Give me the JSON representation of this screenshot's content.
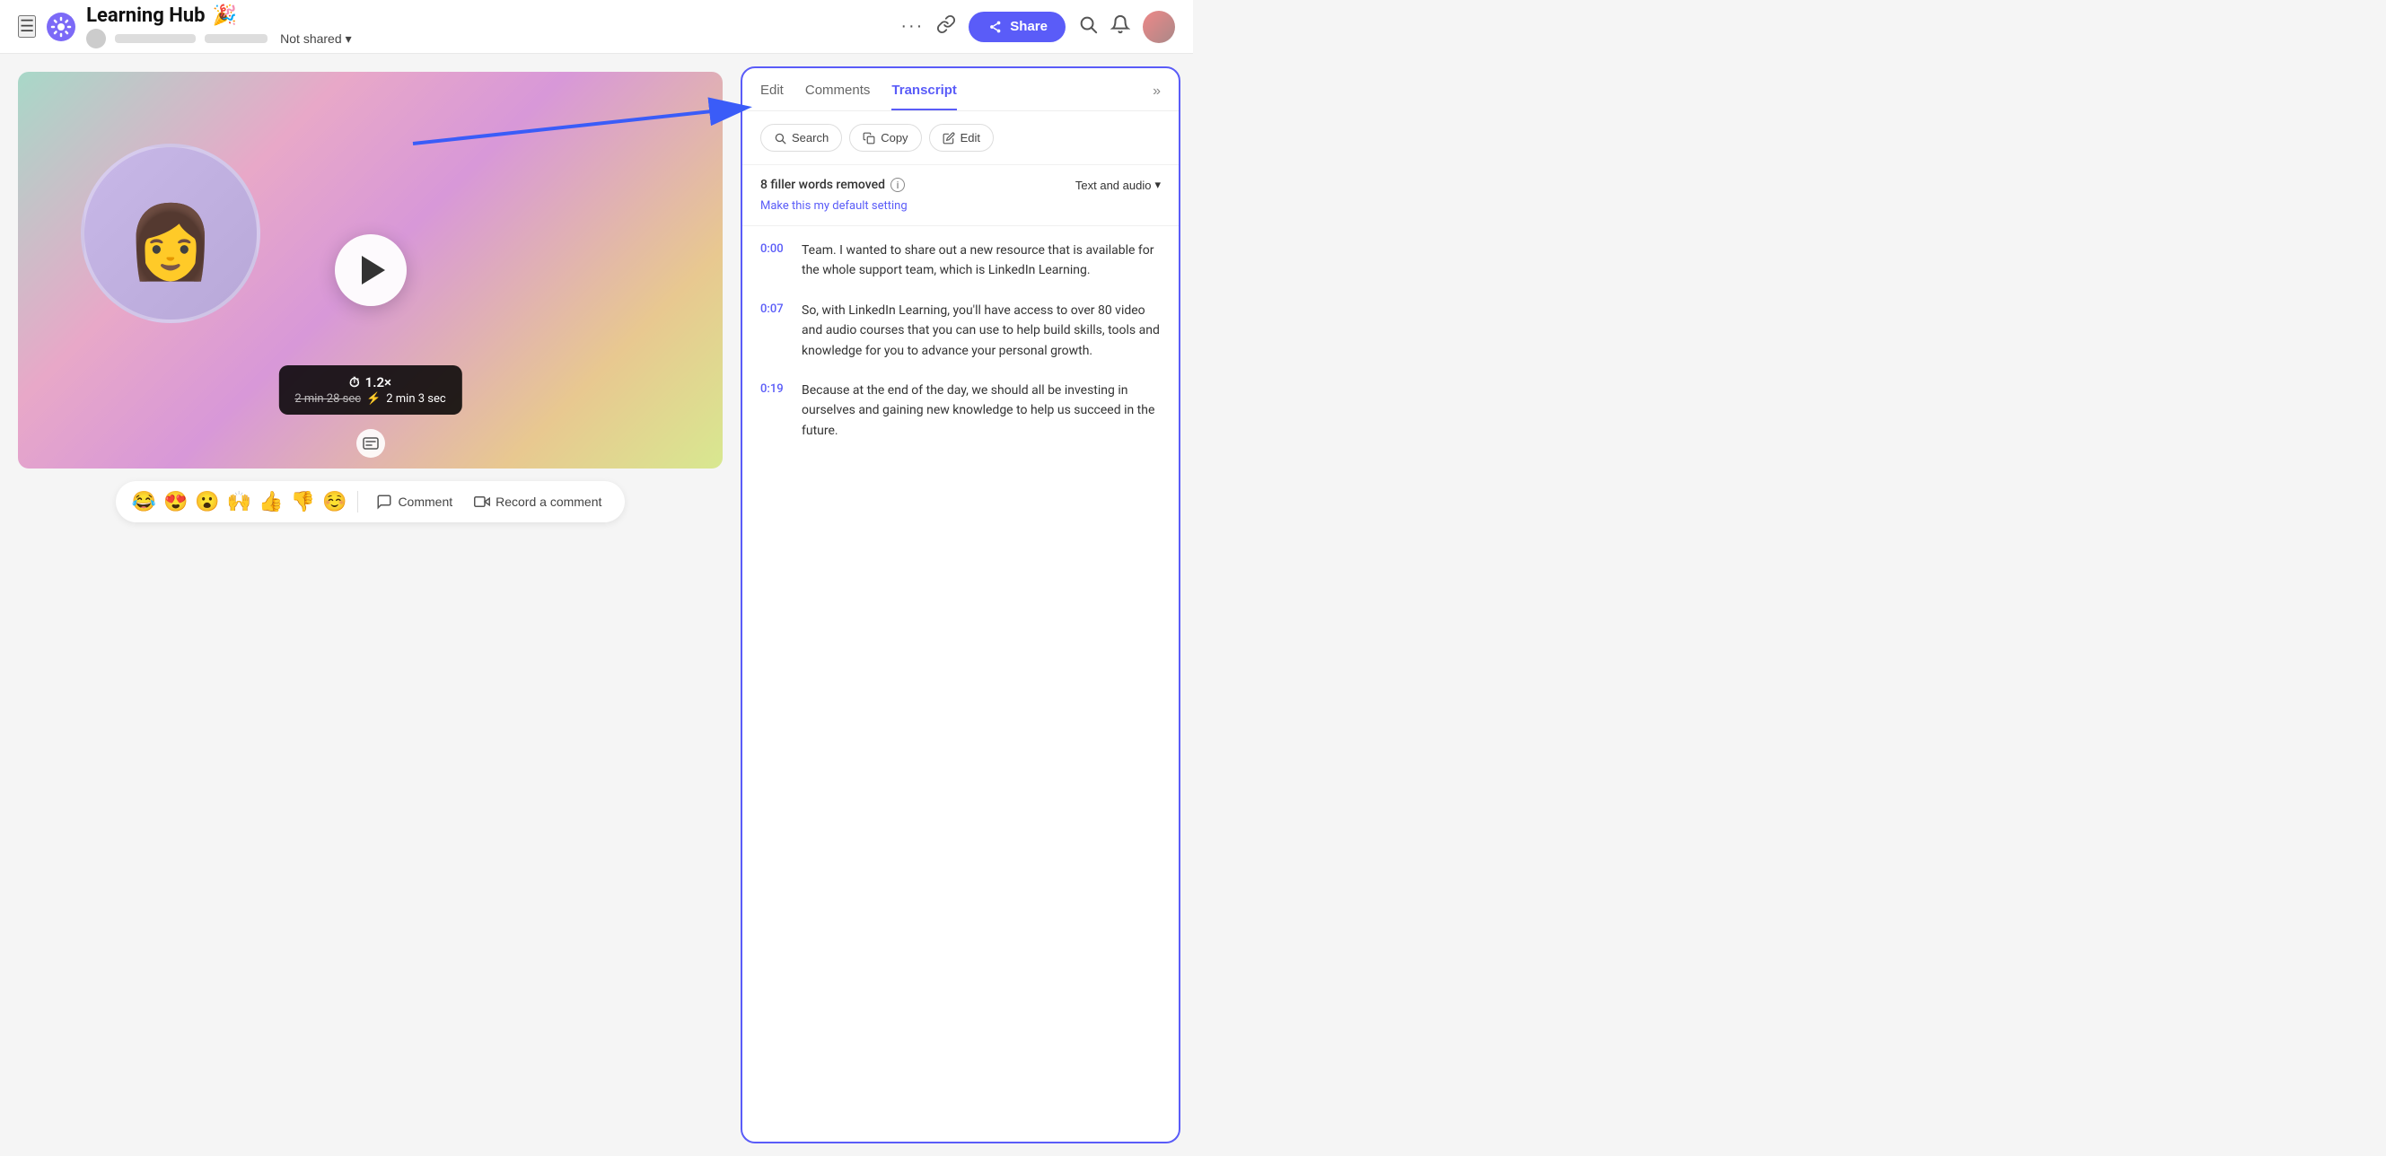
{
  "header": {
    "title": "Learning Hub",
    "title_emoji": "🎉",
    "not_shared_label": "Not shared",
    "share_label": "Share",
    "more_label": "···"
  },
  "tabs": {
    "edit": "Edit",
    "comments": "Comments",
    "transcript": "Transcript"
  },
  "toolbar": {
    "search_label": "Search",
    "copy_label": "Copy",
    "edit_label": "Edit"
  },
  "filler": {
    "label": "8 filler words removed",
    "dropdown_label": "Text and audio",
    "default_link": "Make this my default setting"
  },
  "video": {
    "speed_label": "1.2×",
    "original_duration": "2 min 28 sec",
    "new_duration": "2 min 3 sec"
  },
  "transcript": [
    {
      "time": "0:00",
      "text": "Team. I wanted to share out a new resource that is available for the whole support team, which is LinkedIn Learning."
    },
    {
      "time": "0:07",
      "text": "So, with LinkedIn Learning, you'll have access to over 80 video and audio courses that you can use to help build skills, tools and knowledge for you to advance your personal growth."
    },
    {
      "time": "0:19",
      "text": "Because at the end of the day, we should all be investing in ourselves and gaining new knowledge to help us succeed in the future."
    }
  ],
  "reactions": [
    "😂",
    "😍",
    "😮",
    "🙌",
    "👍",
    "👎"
  ],
  "reaction_more": "☺",
  "comment_label": "Comment",
  "record_label": "Record a comment"
}
